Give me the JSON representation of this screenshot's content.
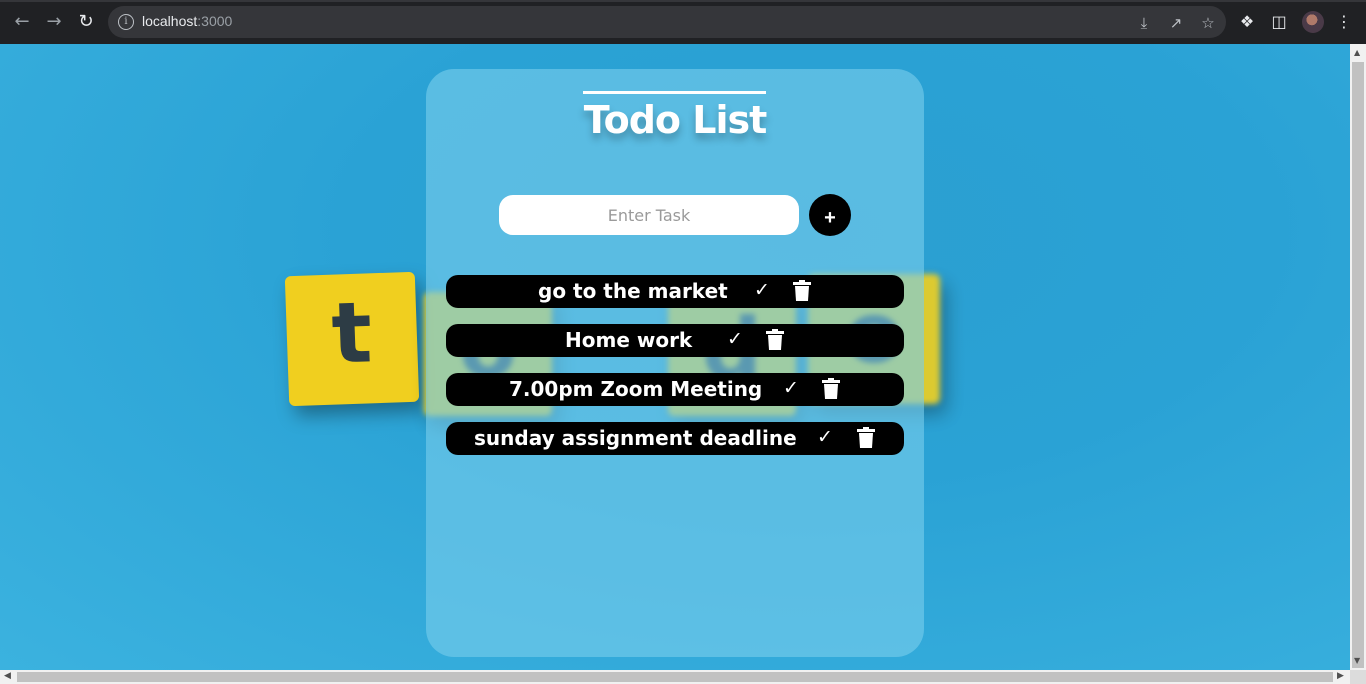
{
  "browser": {
    "url_host": "localhost",
    "url_port": ":3000"
  },
  "app": {
    "title": "Todo List",
    "input_placeholder": "Enter Task",
    "add_label": "+",
    "todos": [
      {
        "text": "go to the market"
      },
      {
        "text": "Home work"
      },
      {
        "text": "7.00pm Zoom Meeting"
      },
      {
        "text": "sunday assignment deadline"
      }
    ],
    "check_glyph": "✓"
  },
  "background": {
    "tile_letters": [
      "t",
      "o",
      "d",
      "o"
    ]
  },
  "colors": {
    "background": "#2aa6d6",
    "card": "rgba(120, 205, 235, 0.62)",
    "todo_bg": "#000000",
    "tile": "#f0cf1f"
  },
  "icons": [
    "back-icon",
    "forward-icon",
    "reload-icon",
    "info-icon",
    "install-icon",
    "share-icon",
    "star-icon",
    "extensions-icon",
    "sidepanel-icon",
    "menu-icon",
    "check-icon",
    "trash-icon"
  ]
}
